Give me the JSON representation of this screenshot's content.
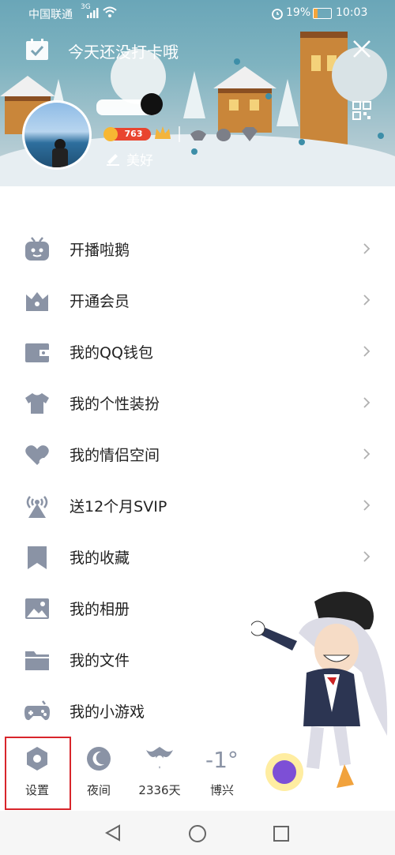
{
  "status_bar": {
    "carrier": "中国联通",
    "network": "3G",
    "battery": "19%",
    "time": "10:03"
  },
  "header": {
    "checkin_text": "今天还没打卡哦",
    "level": "763",
    "signature": "美好"
  },
  "menu": [
    {
      "label": "开播啦鹅",
      "icon": "tv-icon"
    },
    {
      "label": "开通会员",
      "icon": "crown-box-icon"
    },
    {
      "label": "我的QQ钱包",
      "icon": "wallet-icon"
    },
    {
      "label": "我的个性装扮",
      "icon": "shirt-icon"
    },
    {
      "label": "我的情侣空间",
      "icon": "heart-icon"
    },
    {
      "label": "送12个月SVIP",
      "icon": "broadcast-icon"
    },
    {
      "label": "我的收藏",
      "icon": "bookmark-icon"
    },
    {
      "label": "我的相册",
      "icon": "image-icon"
    },
    {
      "label": "我的文件",
      "icon": "folder-icon"
    },
    {
      "label": "我的小游戏",
      "icon": "gamepad-icon"
    }
  ],
  "toolbar": {
    "settings_label": "设置",
    "night_label": "夜间",
    "days_label": "2336天",
    "temperature": "-1°",
    "city_label": "博兴"
  },
  "colors": {
    "icon_gray": "#8a93a5",
    "highlight_red": "#d8252b",
    "level_badge": "#e9452f"
  }
}
